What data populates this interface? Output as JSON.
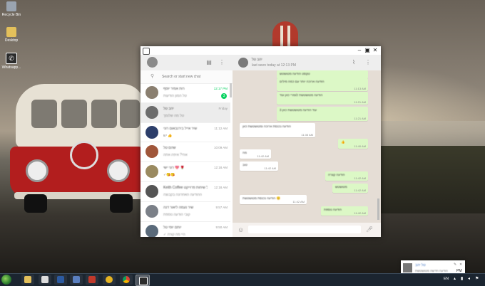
{
  "desktop": {
    "icons": [
      {
        "label": "Recycle Bin",
        "color": "#9aa4b0"
      },
      {
        "label": "Desktop",
        "color": "#e3c05b"
      },
      {
        "label": "Whatsapp...",
        "color": "#2b2b2b"
      }
    ]
  },
  "whatsapp": {
    "search_placeholder": "Search or start new chat",
    "chats": [
      {
        "name": "רות אמיר יוסף",
        "preview": "טל המון הודעות",
        "time": "12:17 PM",
        "unread": "3"
      },
      {
        "name": "יהב טל",
        "preview": "טל מה שלומך",
        "time": "Friday",
        "unread": ""
      },
      {
        "name": "שיר אייל בירנבאום רוני",
        "preview": "יש 👍",
        "time": "11:12 AM",
        "unread": ""
      },
      {
        "name": "שהם טל",
        "preview": "אחי? איפה אתה",
        "time": "10:09 AM",
        "unread": ""
      },
      {
        "name": "רוני ישי 💖 🌹",
        "preview": "✓😘😘",
        "time": "12:18 AM",
        "unread": ""
      },
      {
        "name": "Keith Coffee מעגל שיחות פרוייקט",
        "preview": "ההודעה האחרונה בקבוצה",
        "time": "12:18 AM",
        "unread": ""
      },
      {
        "name": "שיר נעמה ליאור דנה",
        "preview": "קובי הודעה נוספת",
        "time": "9:57 AM",
        "unread": ""
      },
      {
        "name": "יותם יוסי טל",
        "preview": "✓ היי מה קורה",
        "time": "9:50 AM",
        "unread": ""
      }
    ],
    "active_chat": {
      "name": "יהב טל",
      "status": "last seen today at 12:13 PM"
    },
    "messages": [
      {
        "dir": "out",
        "text": "טקסט הודעה מטושטש",
        "time": ""
      },
      {
        "dir": "out",
        "text": "הודעה ארוכה יותר עם כמה מילים",
        "time": "11:13 AM"
      },
      {
        "dir": "out",
        "text": "הודעה מטושטשת לגמרי כאן עוד",
        "time": "11:21 AM"
      },
      {
        "dir": "out",
        "text": "עוד הודעה מטושטשת כאן 3",
        "time": "11:21 AM"
      },
      {
        "dir": "in",
        "text": "הודעה נכנסת ארוכה ומטושטשת כאן",
        "time": "11:35 AM"
      },
      {
        "dir": "out",
        "text": "👍",
        "time": "11:40 AM"
      },
      {
        "dir": "in",
        "text": "מה",
        "time": "11:42 AM"
      },
      {
        "dir": "in",
        "text": "טוב",
        "time": "11:42 AM"
      },
      {
        "dir": "out",
        "text": "הודעה קצרה",
        "time": "11:42 AM"
      },
      {
        "dir": "out",
        "text": "מטושטש",
        "time": "11:42 AM"
      },
      {
        "dir": "in",
        "text": "הודעה נכנסת מטושטשת 😊",
        "time": "11:42 AM"
      },
      {
        "dir": "out",
        "text": "הודעה נוספת",
        "time": "11:42 AM"
      }
    ],
    "compose_value": ""
  },
  "notification": {
    "title": "טל יהב",
    "body": "הודעה חדשה מטושטשת",
    "pm": "PM"
  },
  "taskbar": {
    "lang": "EN"
  }
}
